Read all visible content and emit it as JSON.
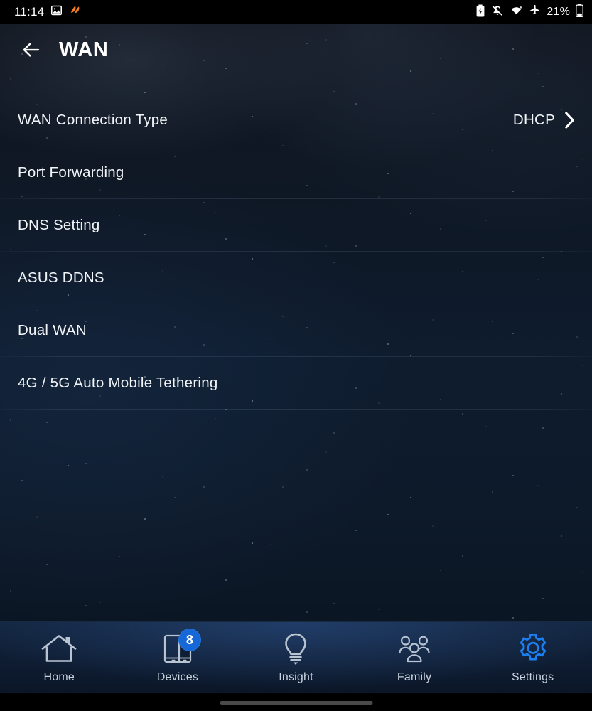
{
  "statusbar": {
    "time": "11:14",
    "battery_percent": "21%",
    "left_icons": [
      {
        "name": "photo-icon"
      },
      {
        "name": "app-notification-icon"
      }
    ],
    "right_icons": [
      {
        "name": "battery-saver-icon"
      },
      {
        "name": "ringer-muted-icon"
      },
      {
        "name": "wifi-6-icon"
      },
      {
        "name": "airplane-mode-icon"
      },
      {
        "name": "battery-icon"
      }
    ]
  },
  "appbar": {
    "back_icon": "back-arrow-icon",
    "title": "WAN"
  },
  "list": {
    "items": [
      {
        "label": "WAN Connection Type",
        "value": "DHCP",
        "chevron": true
      },
      {
        "label": "Port Forwarding",
        "value": "",
        "chevron": false
      },
      {
        "label": "DNS Setting",
        "value": "",
        "chevron": false
      },
      {
        "label": "ASUS DDNS",
        "value": "",
        "chevron": false
      },
      {
        "label": "Dual WAN",
        "value": "",
        "chevron": false
      },
      {
        "label": "4G / 5G Auto Mobile Tethering",
        "value": "",
        "chevron": false
      }
    ]
  },
  "bottomnav": {
    "active": "Settings",
    "accent_color": "#1a7ff0",
    "badge_color": "#1668d8",
    "label_color": "#c9d3e0",
    "tabs": [
      {
        "label": "Home",
        "icon": "home-icon",
        "badge": ""
      },
      {
        "label": "Devices",
        "icon": "devices-icon",
        "badge": "8"
      },
      {
        "label": "Insight",
        "icon": "lightbulb-icon",
        "badge": ""
      },
      {
        "label": "Family",
        "icon": "family-icon",
        "badge": ""
      },
      {
        "label": "Settings",
        "icon": "gear-icon",
        "badge": ""
      }
    ]
  },
  "colors": {
    "background_top": "#10151d",
    "background_bottom": "#0b1624",
    "text_primary": "#f2f5f8",
    "navbar_top": "#12233c"
  }
}
